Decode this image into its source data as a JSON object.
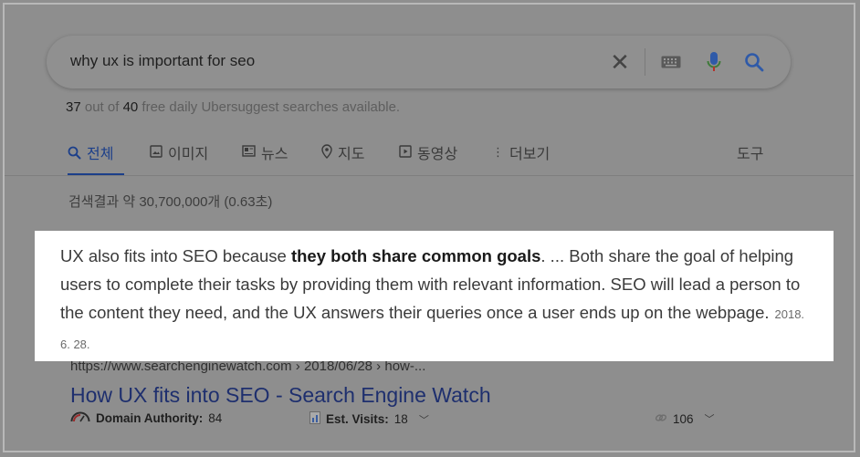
{
  "search": {
    "query": "why ux is important for seo",
    "clear_icon": "close-icon",
    "keyboard_icon": "keyboard-icon",
    "mic_icon": "mic-icon",
    "search_icon": "search-icon"
  },
  "quota": {
    "used": "37",
    "out_of_label": "out of",
    "total": "40",
    "suffix": "free daily Ubersuggest searches available."
  },
  "tabs": [
    {
      "label": "전체",
      "icon": "search-icon",
      "active": true
    },
    {
      "label": "이미지",
      "icon": "image-icon"
    },
    {
      "label": "뉴스",
      "icon": "news-icon"
    },
    {
      "label": "지도",
      "icon": "map-pin-icon"
    },
    {
      "label": "동영상",
      "icon": "video-icon"
    },
    {
      "label": "더보기",
      "icon": "more-vert-icon"
    },
    {
      "label": "도구"
    }
  ],
  "result_stats": "검색결과 약 30,700,000개 (0.63초)",
  "snippet": {
    "before_bold": "UX also fits into SEO because ",
    "bold": "they both share common goals",
    "after_bold": ". ... Both share the goal of helping users to complete their tasks by providing them with relevant information. SEO will lead a person to the content they need, and the UX answers their queries once a user ends up on the webpage.",
    "date": "2018. 6. 28."
  },
  "result": {
    "cite": "https://www.searchenginewatch.com › 2018/06/28 › how-...",
    "title": "How UX fits into SEO - Search Engine Watch",
    "domain_authority_label": "Domain Authority:",
    "domain_authority_value": "84",
    "est_visits_label": "Est. Visits:",
    "est_visits_value": "18",
    "backlinks_value": "106"
  },
  "colors": {
    "overlay_bg": "#8e8e8e",
    "active_tab": "#1c3f8a",
    "result_title": "#1e2f6e",
    "snippet_bg": "#ffffff",
    "mic_blue": "#2f5aa8",
    "mic_red": "#b5322a"
  }
}
